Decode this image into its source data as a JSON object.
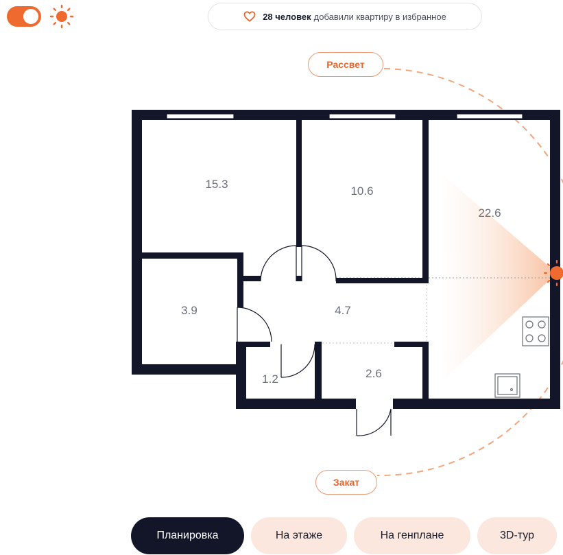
{
  "header": {
    "daylight_toggle": {
      "state": "on",
      "icon": "sun-icon"
    },
    "favorites": {
      "count": "28 человек",
      "text": "добавили квартиру в избранное",
      "icon": "heart-icon"
    }
  },
  "colors": {
    "accent": "#ee6a2f",
    "wall": "#131629",
    "tab_active": "#131629",
    "tab_idle": "#fbe7dd"
  },
  "plan": {
    "rooms": [
      {
        "area": "15.3"
      },
      {
        "area": "10.6"
      },
      {
        "area": "22.6"
      },
      {
        "area": "3.9"
      },
      {
        "area": "4.7"
      },
      {
        "area": "1.2"
      },
      {
        "area": "2.6"
      }
    ],
    "sunrise_label": "Рассвет",
    "sunset_label": "Закат",
    "sun_icon": "sun-icon"
  },
  "tabs": [
    {
      "label": "Планировка",
      "active": true
    },
    {
      "label": "На этаже",
      "active": false
    },
    {
      "label": "На генплане",
      "active": false
    },
    {
      "label": "3D-тур",
      "active": false
    }
  ]
}
